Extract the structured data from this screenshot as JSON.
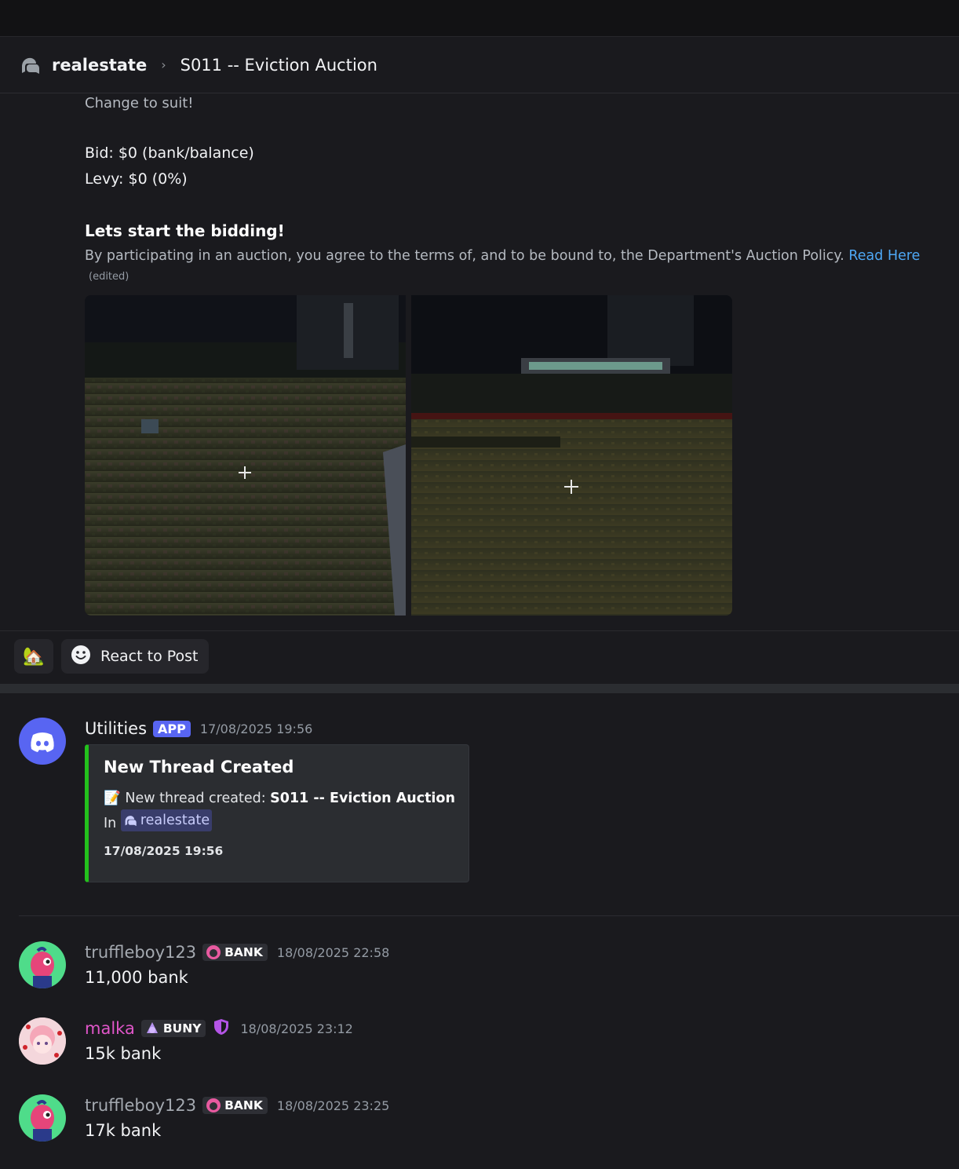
{
  "header": {
    "channel": "realestate",
    "separator": "›",
    "thread": "S011 -- Eviction Auction"
  },
  "post": {
    "line1": "Change to suit!",
    "bid": "Bid: $0 (bank/balance)",
    "levy": "Levy: $0 (0%)",
    "heading": "Lets start the bidding!",
    "policy": "By participating in an auction, you agree to the terms of, and to be bound to, the Department's Auction Policy.",
    "policy_link": "Read Here",
    "edited": "(edited)"
  },
  "reactions": {
    "emoji": "🏡",
    "react_label": "React to Post"
  },
  "messages": [
    {
      "author": "Utilities",
      "tag": "APP",
      "timestamp": "17/08/2025 19:56",
      "embed": {
        "title": "New Thread Created",
        "emoji": "📝",
        "desc_prefix": "New thread created:",
        "thread_name": "S011 -- Eviction Auction",
        "in_label": "In",
        "channel": "realestate",
        "footer": "17/08/2025 19:56",
        "accent": "#23c11c"
      }
    },
    {
      "author": "truffleboy123",
      "role": "BANK",
      "timestamp": "18/08/2025 22:58",
      "text": "11,000 bank"
    },
    {
      "author": "malka",
      "role": "BUNY",
      "timestamp": "18/08/2025 23:12",
      "text": "15k bank"
    },
    {
      "author": "truffleboy123",
      "role": "BANK",
      "timestamp": "18/08/2025 23:25",
      "text": "17k bank"
    }
  ],
  "colors": {
    "background": "#1a1a1e",
    "link": "#4ea8f5",
    "app_tag": "#5865f2",
    "truffleboy_name": "#a4a9b0",
    "malka_name": "#e056c9"
  }
}
